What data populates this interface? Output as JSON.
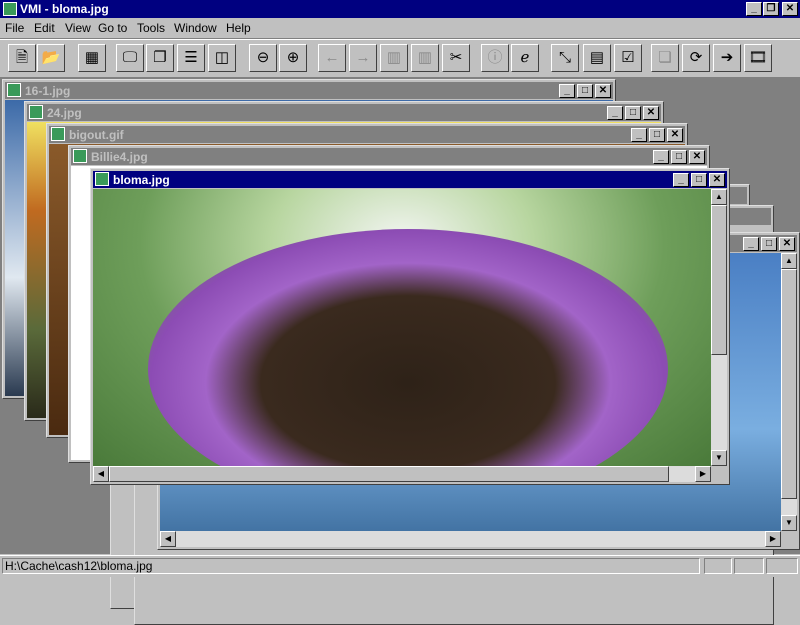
{
  "app": {
    "title": "VMI - bloma.jpg"
  },
  "menu": [
    "File",
    "Edit",
    "View",
    "Go to",
    "Tools",
    "Window",
    "Help"
  ],
  "toolbar": [
    {
      "icon": "open-image-icon",
      "glyph": "🗎"
    },
    {
      "icon": "open-folder-icon",
      "glyph": "📂"
    },
    {
      "icon": "thumbnails-icon",
      "glyph": "▦"
    },
    {
      "icon": "monitor-icon",
      "glyph": "🖵"
    },
    {
      "icon": "cascade-icon",
      "glyph": "❐"
    },
    {
      "icon": "tile-horizontal-icon",
      "glyph": "☰"
    },
    {
      "icon": "tile-vertical-icon",
      "glyph": "◫"
    },
    {
      "icon": "zoom-out-icon",
      "glyph": "⊖"
    },
    {
      "icon": "zoom-in-icon",
      "glyph": "⊕"
    },
    {
      "icon": "previous-icon",
      "glyph": "←"
    },
    {
      "icon": "next-icon",
      "glyph": "→"
    },
    {
      "icon": "film-first-icon",
      "glyph": "▥"
    },
    {
      "icon": "film-last-icon",
      "glyph": "▥"
    },
    {
      "icon": "slideshow-icon",
      "glyph": "✂"
    },
    {
      "icon": "info-icon",
      "glyph": "ⓘ"
    },
    {
      "icon": "internet-icon",
      "glyph": "ℯ"
    },
    {
      "icon": "resize-icon",
      "glyph": "⤡"
    },
    {
      "icon": "properties-icon",
      "glyph": "▤"
    },
    {
      "icon": "settings-icon",
      "glyph": "☑"
    },
    {
      "icon": "copy-icon",
      "glyph": "❏"
    },
    {
      "icon": "refresh-icon",
      "glyph": "⟳"
    },
    {
      "icon": "export-icon",
      "glyph": "➔"
    },
    {
      "icon": "movie-icon",
      "glyph": "🎞"
    }
  ],
  "windows": [
    {
      "name": "16-1.jpg"
    },
    {
      "name": "24.jpg"
    },
    {
      "name": "bigout.gif"
    },
    {
      "name": "Billie4.jpg"
    },
    {
      "name": "bloma.jpg"
    }
  ],
  "status": {
    "path": "H:\\Cache\\cash12\\bloma.jpg"
  }
}
